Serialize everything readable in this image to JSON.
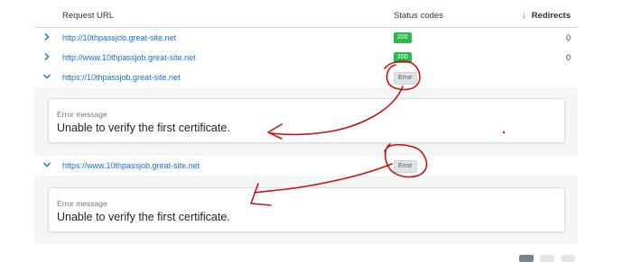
{
  "table": {
    "headers": {
      "url": "Request URL",
      "status": "Status codes",
      "redirects": "Redirects",
      "sort_icon": "arrow-down-icon"
    },
    "rows": [
      {
        "url": "http://10thpassjob.great-site.net",
        "status": "200",
        "redirects": "0",
        "expanded": false
      },
      {
        "url": "http://www.10thpassjob.great-site.net",
        "status": "200",
        "redirects": "0",
        "expanded": false
      },
      {
        "url": "https://10thpassjob.great-site.net",
        "status": "Error",
        "redirects": "",
        "expanded": true
      },
      {
        "url": "https://www.10thpassjob.great-site.net",
        "status": "Error",
        "redirects": "",
        "expanded": true
      }
    ]
  },
  "errors": [
    {
      "label": "Error message",
      "message": "Unable to verify the first certificate."
    },
    {
      "label": "Error message",
      "message": "Unable to verify the first certificate."
    }
  ],
  "colors": {
    "link": "#1a6fbf",
    "ok_badge": "#2db84d",
    "error_badge": "#dfe3e7",
    "annotation": "#cc1111"
  }
}
